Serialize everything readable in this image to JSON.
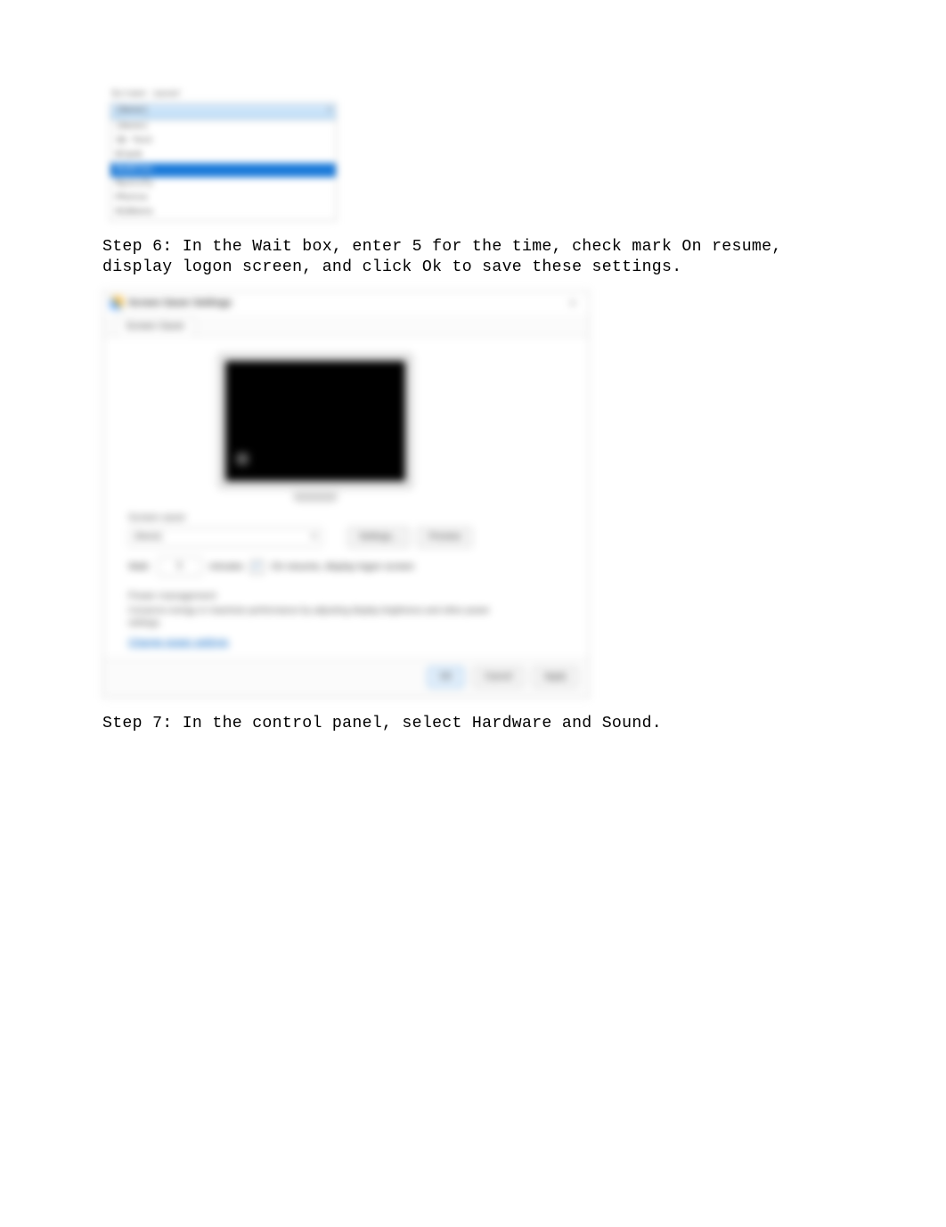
{
  "dropdown": {
    "label": "Screen saver",
    "selected": "(None)",
    "items": [
      "(None)",
      "3D Text",
      "Blank",
      "Bubbles",
      "Mystify",
      "Photos",
      "Ribbons"
    ],
    "current_index": 3
  },
  "steps": {
    "s6": "Step 6:  In the Wait box, enter 5 for the time, check mark On resume, display logon screen, and click Ok to save these settings.",
    "s7": "Step 7:  In the control panel, select Hardware and Sound."
  },
  "dialog": {
    "title": "Screen Saver Settings",
    "close": "×",
    "tab": "Screen Saver",
    "section_ss": "Screen saver",
    "ss_value": "(None)",
    "settings_btn": "Settings...",
    "preview_btn": "Preview",
    "wait_label": "Wait:",
    "wait_value": "5",
    "wait_minutes": "minutes",
    "checkbox_label": "On resume, display logon screen",
    "pm_title": "Power management",
    "pm_text": "Conserve energy or maximize performance by adjusting display brightness and other power settings.",
    "pm_link": "Change power settings",
    "ok": "OK",
    "cancel": "Cancel",
    "apply": "Apply"
  }
}
